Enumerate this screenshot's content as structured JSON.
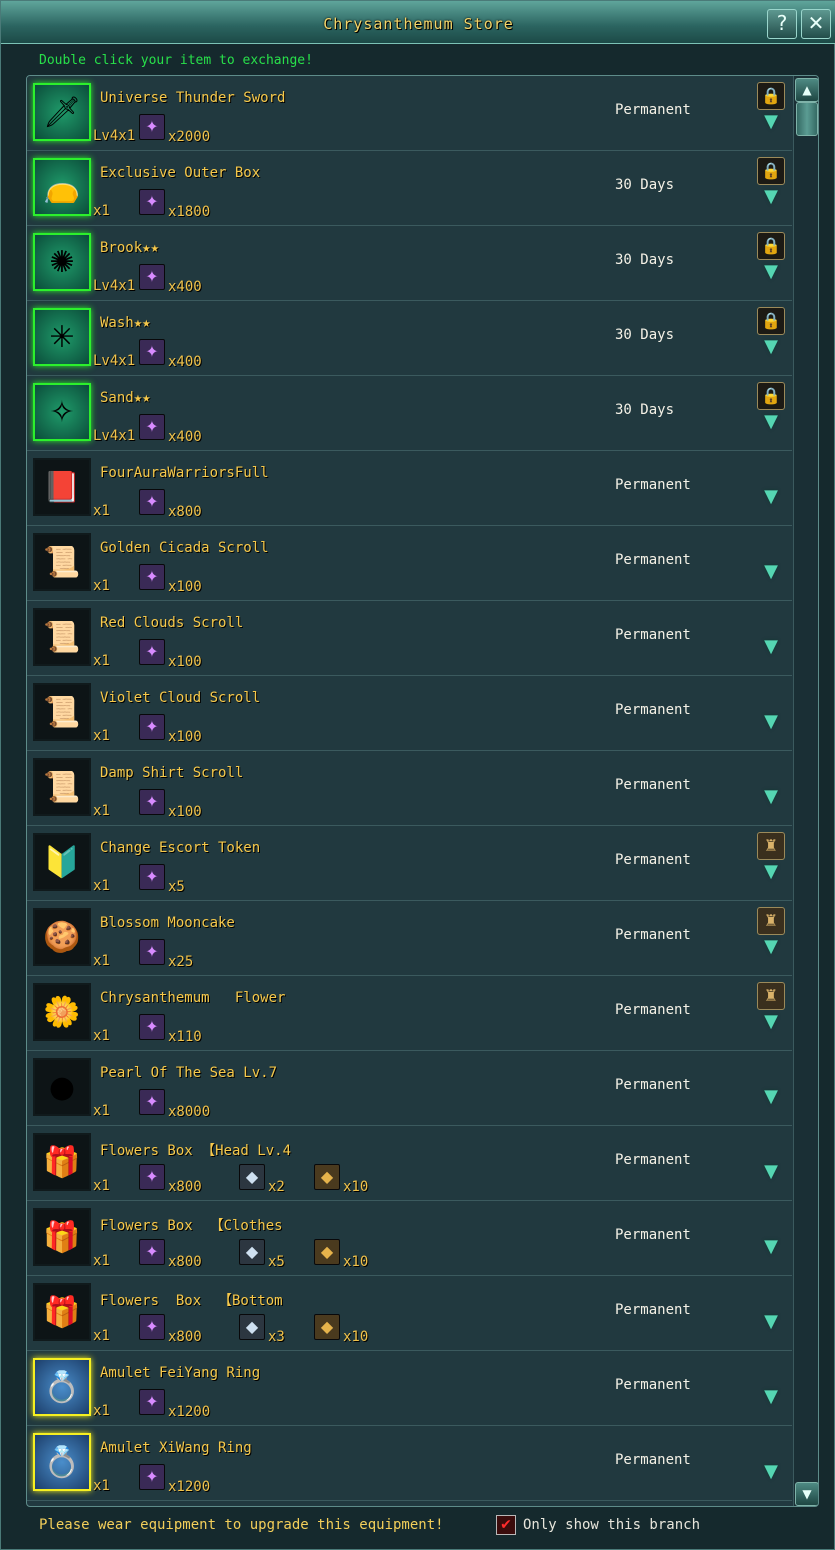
{
  "window": {
    "title": "Chrysanthemum Store",
    "help_label": "?",
    "close_label": "✕"
  },
  "instruction": "Double click your item to exchange!",
  "footer": {
    "notice": "Please wear equipment to upgrade this equipment!",
    "checkbox_label": "Only show this branch",
    "checkbox_checked": true
  },
  "items": [
    {
      "name": "Universe Thunder Sword",
      "qty": "Lv4x1",
      "icon": "sword-icon",
      "frame": "green",
      "costs": [
        {
          "currency": "purple-crystal",
          "amount": "x2000"
        }
      ],
      "duration": "Permanent",
      "badge": "lock"
    },
    {
      "name": "Exclusive Outer Box",
      "qty": "x1",
      "icon": "pouch-icon",
      "frame": "green",
      "costs": [
        {
          "currency": "purple-crystal",
          "amount": "x1800"
        }
      ],
      "duration": "30 Days",
      "badge": "lock"
    },
    {
      "name": "Brook★★",
      "qty": "Lv4x1",
      "icon": "ring-aura-icon",
      "frame": "green",
      "costs": [
        {
          "currency": "purple-crystal",
          "amount": "x400"
        }
      ],
      "duration": "30 Days",
      "badge": "lock"
    },
    {
      "name": "Wash★★",
      "qty": "Lv4x1",
      "icon": "star-aura-icon",
      "frame": "green",
      "costs": [
        {
          "currency": "purple-crystal",
          "amount": "x400"
        }
      ],
      "duration": "30 Days",
      "badge": "lock"
    },
    {
      "name": "Sand★★",
      "qty": "Lv4x1",
      "icon": "swirl-aura-icon",
      "frame": "green",
      "costs": [
        {
          "currency": "purple-crystal",
          "amount": "x400"
        }
      ],
      "duration": "30 Days",
      "badge": "lock"
    },
    {
      "name": "FourAuraWarriorsFull",
      "qty": "x1",
      "icon": "book-icon",
      "frame": "plain",
      "costs": [
        {
          "currency": "purple-crystal",
          "amount": "x800"
        }
      ],
      "duration": "Permanent",
      "badge": ""
    },
    {
      "name": "Golden Cicada Scroll",
      "qty": "x1",
      "icon": "scroll-icon",
      "frame": "plain",
      "costs": [
        {
          "currency": "purple-crystal",
          "amount": "x100"
        }
      ],
      "duration": "Permanent",
      "badge": ""
    },
    {
      "name": "Red Clouds Scroll",
      "qty": "x1",
      "icon": "scroll-icon",
      "frame": "plain",
      "costs": [
        {
          "currency": "purple-crystal",
          "amount": "x100"
        }
      ],
      "duration": "Permanent",
      "badge": ""
    },
    {
      "name": "Violet Cloud Scroll",
      "qty": "x1",
      "icon": "scroll-icon",
      "frame": "plain",
      "costs": [
        {
          "currency": "purple-crystal",
          "amount": "x100"
        }
      ],
      "duration": "Permanent",
      "badge": ""
    },
    {
      "name": "Damp Shirt Scroll",
      "qty": "x1",
      "icon": "scroll-icon",
      "frame": "plain",
      "costs": [
        {
          "currency": "purple-crystal",
          "amount": "x100"
        }
      ],
      "duration": "Permanent",
      "badge": ""
    },
    {
      "name": "Change Escort Token",
      "qty": "x1",
      "icon": "token-icon",
      "frame": "plain",
      "costs": [
        {
          "currency": "purple-crystal",
          "amount": "x5"
        }
      ],
      "duration": "Permanent",
      "badge": "bag"
    },
    {
      "name": "Blossom Mooncake",
      "qty": "x1",
      "icon": "mooncake-icon",
      "frame": "plain",
      "costs": [
        {
          "currency": "purple-crystal",
          "amount": "x25"
        }
      ],
      "duration": "Permanent",
      "badge": "bag"
    },
    {
      "name": "Chrysanthemum   Flower",
      "qty": "x1",
      "icon": "flower-icon",
      "frame": "plain",
      "costs": [
        {
          "currency": "purple-crystal",
          "amount": "x110"
        }
      ],
      "duration": "Permanent",
      "badge": "bag"
    },
    {
      "name": "Pearl Of The Sea Lv.7",
      "qty": "x1",
      "icon": "pearl-icon",
      "frame": "plain",
      "costs": [
        {
          "currency": "purple-crystal",
          "amount": "x8000"
        }
      ],
      "duration": "Permanent",
      "badge": ""
    },
    {
      "name": "Flowers Box 【Head Lv.4",
      "qty": "x1",
      "icon": "gift-box-icon",
      "frame": "plain",
      "costs": [
        {
          "currency": "purple-crystal",
          "amount": "x800"
        },
        {
          "currency": "silver-ore",
          "amount": "x2"
        },
        {
          "currency": "gold-ore",
          "amount": "x10"
        }
      ],
      "duration": "Permanent",
      "badge": ""
    },
    {
      "name": "Flowers Box  【Clothes",
      "qty": "x1",
      "icon": "gift-box-icon",
      "frame": "plain",
      "costs": [
        {
          "currency": "purple-crystal",
          "amount": "x800"
        },
        {
          "currency": "silver-ore",
          "amount": "x5"
        },
        {
          "currency": "gold-ore",
          "amount": "x10"
        }
      ],
      "duration": "Permanent",
      "badge": ""
    },
    {
      "name": "Flowers  Box  【Bottom",
      "qty": "x1",
      "icon": "gift-box-icon",
      "frame": "plain",
      "costs": [
        {
          "currency": "purple-crystal",
          "amount": "x800"
        },
        {
          "currency": "silver-ore",
          "amount": "x3"
        },
        {
          "currency": "gold-ore",
          "amount": "x10"
        }
      ],
      "duration": "Permanent",
      "badge": ""
    },
    {
      "name": "Amulet FeiYang Ring",
      "qty": "x1",
      "icon": "ring-icon",
      "frame": "yellow",
      "costs": [
        {
          "currency": "purple-crystal",
          "amount": "x1200"
        }
      ],
      "duration": "Permanent",
      "badge": ""
    },
    {
      "name": "Amulet XiWang Ring",
      "qty": "x1",
      "icon": "ring-icon",
      "frame": "yellow",
      "costs": [
        {
          "currency": "purple-crystal",
          "amount": "x1200"
        }
      ],
      "duration": "Permanent",
      "badge": ""
    }
  ]
}
